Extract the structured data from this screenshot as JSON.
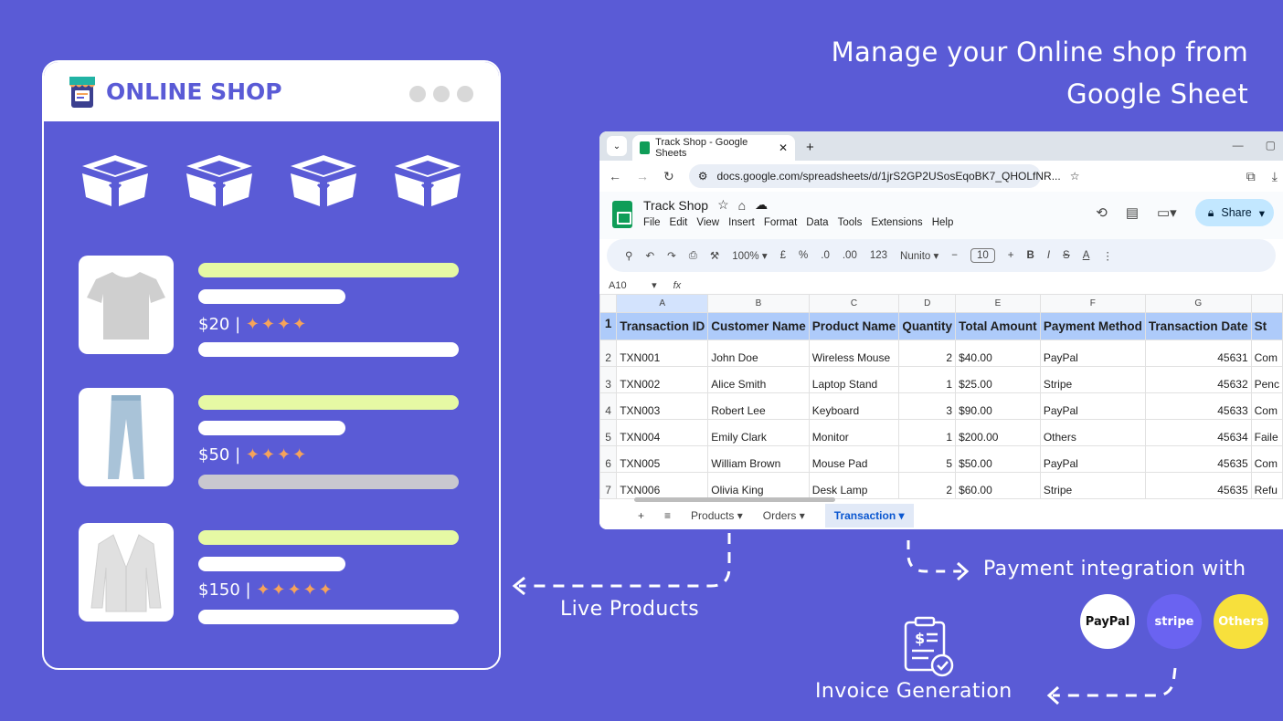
{
  "headline": {
    "line1": "Manage your Online shop from",
    "line2": "Google Sheet"
  },
  "shop": {
    "title": "ONLINE SHOP",
    "products": [
      {
        "name": "tshirt",
        "price": "$20",
        "stars": "✦✦✦✦"
      },
      {
        "name": "jeans",
        "price": "$50",
        "stars": "✦✦✦✦"
      },
      {
        "name": "cardigan",
        "price": "$150",
        "stars": "✦✦✦✦✦"
      }
    ]
  },
  "browser": {
    "tab_title": "Track Shop - Google Sheets",
    "tab_close": "✕",
    "new_tab": "+",
    "url": "docs.google.com/spreadsheets/d/1jrS2GP2USosEqoBK7_QHOLfNR...",
    "doc_title": "Track Shop",
    "menus": [
      "File",
      "Edit",
      "View",
      "Insert",
      "Format",
      "Data",
      "Tools",
      "Extensions",
      "Help"
    ],
    "share_label": "Share",
    "toolbar": {
      "zoom": "100%",
      "currency": "£",
      "percent": "%",
      "dec_less": ".0",
      "dec_more": ".00",
      "format123": "123",
      "font": "Nunito",
      "font_size": "10",
      "bold": "B",
      "italic": "I"
    },
    "cell_ref": "A10",
    "fx": "fx"
  },
  "sheet": {
    "columns": [
      "A",
      "B",
      "C",
      "D",
      "E",
      "F",
      "G",
      ""
    ],
    "row_numbers": [
      "1",
      "2",
      "3",
      "4",
      "5",
      "6",
      "7"
    ],
    "headers": [
      "Transaction ID",
      "Customer Name",
      "Product Name",
      "Quantity",
      "Total Amount",
      "Payment Method",
      "Transaction Date",
      "St"
    ],
    "rows": [
      [
        "TXN001",
        "John Doe",
        "Wireless Mouse",
        "2",
        "$40.00",
        "PayPal",
        "45631",
        "Com"
      ],
      [
        "TXN002",
        "Alice Smith",
        "Laptop Stand",
        "1",
        "$25.00",
        "Stripe",
        "45632",
        "Penc"
      ],
      [
        "TXN003",
        "Robert Lee",
        "Keyboard",
        "3",
        "$90.00",
        "PayPal",
        "45633",
        "Com"
      ],
      [
        "TXN004",
        "Emily Clark",
        "Monitor",
        "1",
        "$200.00",
        "Others",
        "45634",
        "Faile"
      ],
      [
        "TXN005",
        "William Brown",
        "Mouse Pad",
        "5",
        "$50.00",
        "PayPal",
        "45635",
        "Com"
      ],
      [
        "TXN006",
        "Olivia King",
        "Desk Lamp",
        "2",
        "$60.00",
        "Stripe",
        "45635",
        "Refu"
      ]
    ],
    "tabs": [
      "Products",
      "Orders",
      "Transaction"
    ],
    "active_tab": "Transaction"
  },
  "annotations": {
    "live_products": "Live Products",
    "payment": "Payment  integration with",
    "invoice": "Invoice Generation"
  },
  "payments": [
    {
      "label": "PayPal",
      "bg": "#ffffff",
      "fg": "#111111"
    },
    {
      "label": "stripe",
      "bg": "#6a63f1",
      "fg": "#ffffff"
    },
    {
      "label": "Others",
      "bg": "#f7e03c",
      "fg": "#ffffff"
    }
  ],
  "colors": {
    "background": "#5a5bd6",
    "bar_green": "#e6f9a4",
    "star": "#f6a35a",
    "sheet_header": "#aecbfa"
  }
}
